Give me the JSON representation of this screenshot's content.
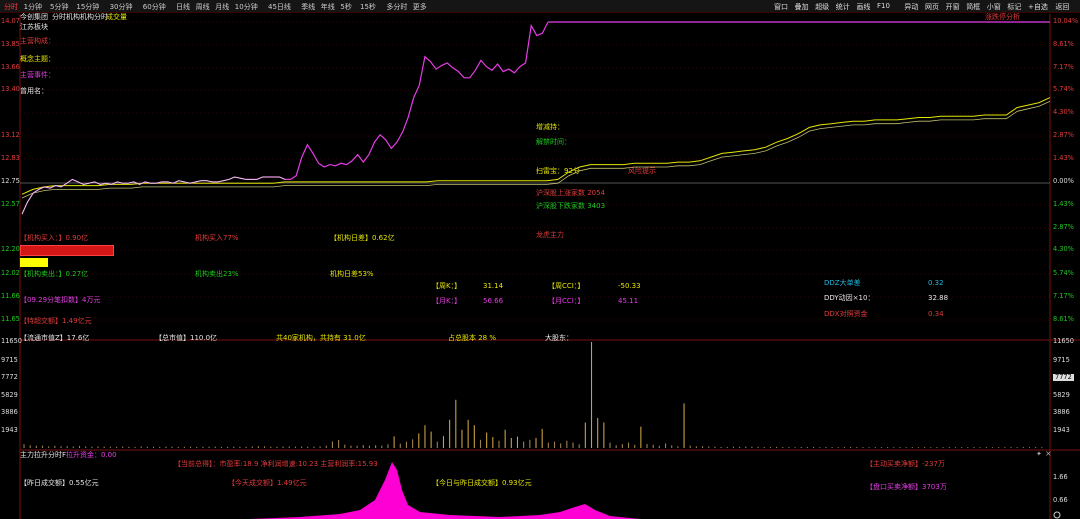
{
  "toolbar": {
    "tabs": [
      "分时",
      "1分钟",
      "5分钟",
      "15分钟",
      "30分钟",
      "60分钟",
      "日线",
      "周线",
      "月线",
      "10分钟",
      "45日线",
      "季线",
      "年线",
      "5秒",
      "15秒",
      "多分时",
      "更多"
    ],
    "tools": [
      "窗口",
      "叠加",
      "超级",
      "统计",
      "画线",
      "F10",
      "异动",
      "网页",
      "开窗",
      "简框",
      "小窗",
      "标记",
      "+自选",
      "返回"
    ]
  },
  "chart_header": {
    "stock_name": "今创集团",
    "mode_labels": [
      "分时",
      "机构机构分时",
      "成交量"
    ],
    "right_label": "涨跌停分析"
  },
  "price_axis": {
    "left": [
      "14.07",
      "13.85",
      "13.66",
      "13.40",
      "13.12",
      "12.83",
      "12.75",
      "12.57",
      "12.20",
      "12.02",
      "11.66",
      "11.65"
    ],
    "right": [
      "10.04%",
      "8.61%",
      "7.17%",
      "5.74%",
      "4.30%",
      "2.87%",
      "1.43%",
      "0.00%",
      "1.43%",
      "2.87%",
      "4.30%",
      "5.74%",
      "7.17%",
      "8.61%"
    ]
  },
  "volume_axis": {
    "left": [
      "11650",
      "9715",
      "7772",
      "5829",
      "3886",
      "1943"
    ],
    "right": [
      "11650",
      "9715",
      "7772",
      "5829",
      "3886",
      "1943"
    ],
    "right_highlight": "7772"
  },
  "indicator_axis": {
    "right": [
      "1.66",
      "0.66"
    ]
  },
  "info_left": {
    "sector": "江苏板块",
    "concept_label": "主营构成：",
    "concept_main": "概念主题：",
    "main_business": "主营事件：",
    "alias": "曾用名："
  },
  "info_right": {
    "reduce": "增减持：",
    "unlock": "解禁时间：",
    "score": "扫雷宝：92分",
    "risk": "风险提示",
    "hk_up": "沪深股上涨家数 2054",
    "hk_down": "沪深股下跌家数 3403",
    "dragon": "龙虎主力"
  },
  "fund_flow": {
    "inst_buy": "【机构买入：】0.90亿",
    "inst_buy_ratio": "机构买入77%",
    "inst_diff": "【机构日差】0.62亿",
    "inst_sell": "【机构卖出：】0.27亿",
    "inst_sell_ratio": "机构卖出23%",
    "inst_diff_ratio": "机构日差53%",
    "buy_bar_ratio": 0.77,
    "sell_bar_ratio": 0.23,
    "big_order": "【09.29分笔扣数】4万元",
    "super_turnover": "【特超交额】1.49亿元"
  },
  "kdj": {
    "week_k_label": "【周K：】",
    "week_k_value": "31.14",
    "week_cci_label": "【周CCI：】",
    "week_cci_value": "-50.33",
    "month_k_label": "【月K：】",
    "month_k_value": "56.66",
    "month_cci_label": "【月CCI：】",
    "month_cci_value": "45.11"
  },
  "ddx": {
    "ddz_label": "DDZ大单差",
    "ddz_value": "0.32",
    "ddy_label": "DDY动因×10：",
    "ddy_value": "32.88",
    "ddx_label": "DDX对照资金",
    "ddx_value": "0.34"
  },
  "summary_row": {
    "circ": "【流通市值Z】17.6亿",
    "total": "【总市值】110.0亿",
    "inst_hold": "共40家机构，共持有 31.0亿",
    "ratio": "占总股本 28 %",
    "holder": "大股东："
  },
  "volume_header": {
    "title": "主力拉升分时F",
    "value_label": "拉升资金：0.00"
  },
  "bottom_panel": {
    "market_scan": "【当前总得】：市盈率:18.9 净利润增速:10.23 主营利润率:15.93",
    "net_buy": "【主动买卖净额】-237万",
    "yday_volume": "【昨日成交额】0.55亿元",
    "today_volume": "【今天成交额】1.49亿元",
    "ratio_volume": "【今日与昨日成交额】0.93亿元",
    "open_buy": "【盘口买卖净额】3703万"
  },
  "chart_data": {
    "type": "line",
    "ylim": [
      11.65,
      14.07
    ],
    "prev_close": 12.75,
    "price_series": [
      12.52,
      12.62,
      12.69,
      12.72,
      12.74,
      12.73,
      12.75,
      12.74,
      12.77,
      12.8,
      12.78,
      12.76,
      12.77,
      12.78,
      12.76,
      12.77,
      12.76,
      12.78,
      12.77,
      12.77,
      12.78,
      12.76,
      12.78,
      12.77,
      12.77,
      12.78,
      12.78,
      12.77,
      12.79,
      12.78,
      12.77,
      12.78,
      12.79,
      12.79,
      12.78,
      12.78,
      12.79,
      12.8,
      12.82,
      12.81,
      12.8,
      12.8,
      12.8,
      12.82,
      12.82,
      12.82,
      12.82,
      12.8,
      12.8,
      12.83,
      12.98,
      13.08,
      13.01,
      12.93,
      12.9,
      12.92,
      12.91,
      12.93,
      12.92,
      12.95,
      13.0,
      12.94,
      13.0,
      13.1,
      13.16,
      13.12,
      13.05,
      13.1,
      13.18,
      13.3,
      13.46,
      13.56,
      13.79,
      13.75,
      13.69,
      13.72,
      13.74,
      13.7,
      13.67,
      13.62,
      13.62,
      13.68,
      13.76,
      13.71,
      13.68,
      13.73,
      13.67,
      13.69,
      13.66,
      13.71,
      13.74,
      14.04,
      13.96,
      13.98,
      14.07
    ],
    "avg_series": [
      12.68,
      12.72,
      12.74,
      12.75,
      12.75,
      12.75,
      12.75,
      12.75,
      12.76,
      12.76,
      12.76,
      12.77,
      12.77,
      12.77,
      12.77,
      12.77,
      12.77,
      12.77,
      12.77,
      12.77,
      12.77,
      12.77,
      12.77,
      12.77,
      12.78,
      12.78,
      12.78,
      12.78,
      12.78,
      12.78,
      12.78,
      12.78,
      12.78,
      12.78,
      12.78,
      12.78,
      12.78,
      12.78,
      12.79,
      12.79,
      12.79,
      12.79,
      12.79,
      12.79,
      12.79,
      12.79,
      12.79,
      12.79,
      12.79,
      12.8,
      12.86,
      12.9,
      12.92,
      12.92,
      12.92,
      12.92,
      12.93,
      12.93,
      12.93,
      12.93,
      12.94,
      12.94,
      12.95,
      12.98,
      13.01,
      13.02,
      13.03,
      13.04,
      13.06,
      13.1,
      13.13,
      13.17,
      13.22,
      13.24,
      13.25,
      13.26,
      13.27,
      13.27,
      13.28,
      13.28,
      13.28,
      13.29,
      13.3,
      13.3,
      13.31,
      13.31,
      13.31,
      13.31,
      13.32,
      13.32,
      13.32,
      13.38,
      13.4,
      13.42,
      13.46
    ],
    "volume_series": [
      420,
      300,
      250,
      260,
      180,
      240,
      190,
      200,
      160,
      230,
      170,
      140,
      160,
      150,
      140,
      130,
      150,
      140,
      120,
      160,
      140,
      130,
      120,
      150,
      140,
      120,
      130,
      140,
      120,
      130,
      140,
      150,
      120,
      130,
      140,
      130,
      120,
      160,
      200,
      180,
      150,
      140,
      160,
      170,
      150,
      160,
      140,
      150,
      170,
      260,
      720,
      880,
      360,
      260,
      260,
      330,
      250,
      300,
      260,
      400,
      1280,
      480,
      700,
      950,
      1600,
      2500,
      1800,
      700,
      1300,
      3100,
      5300,
      2000,
      3100,
      2500,
      900,
      1700,
      1200,
      800,
      2000,
      1100,
      1250,
      700,
      900,
      1100,
      2100,
      600,
      700,
      500,
      800,
      600,
      400,
      2800,
      11650,
      3300,
      2800,
      600,
      300,
      420,
      600,
      350,
      2350,
      450,
      360,
      240,
      500,
      300,
      200,
      4900,
      260,
      180,
      200,
      160,
      140,
      120,
      110,
      150,
      130,
      160,
      140,
      120,
      110,
      100,
      120,
      110,
      100,
      90,
      120,
      100,
      110,
      90,
      120,
      100,
      90,
      100,
      110,
      90,
      100,
      90,
      100,
      90,
      100,
      90,
      100,
      90,
      100,
      90,
      100,
      90,
      100,
      90,
      100,
      90,
      100,
      90,
      100,
      90,
      100,
      90,
      100,
      90,
      100,
      90,
      100,
      90,
      100,
      90
    ],
    "ylim_volume": [
      0,
      11650
    ]
  }
}
